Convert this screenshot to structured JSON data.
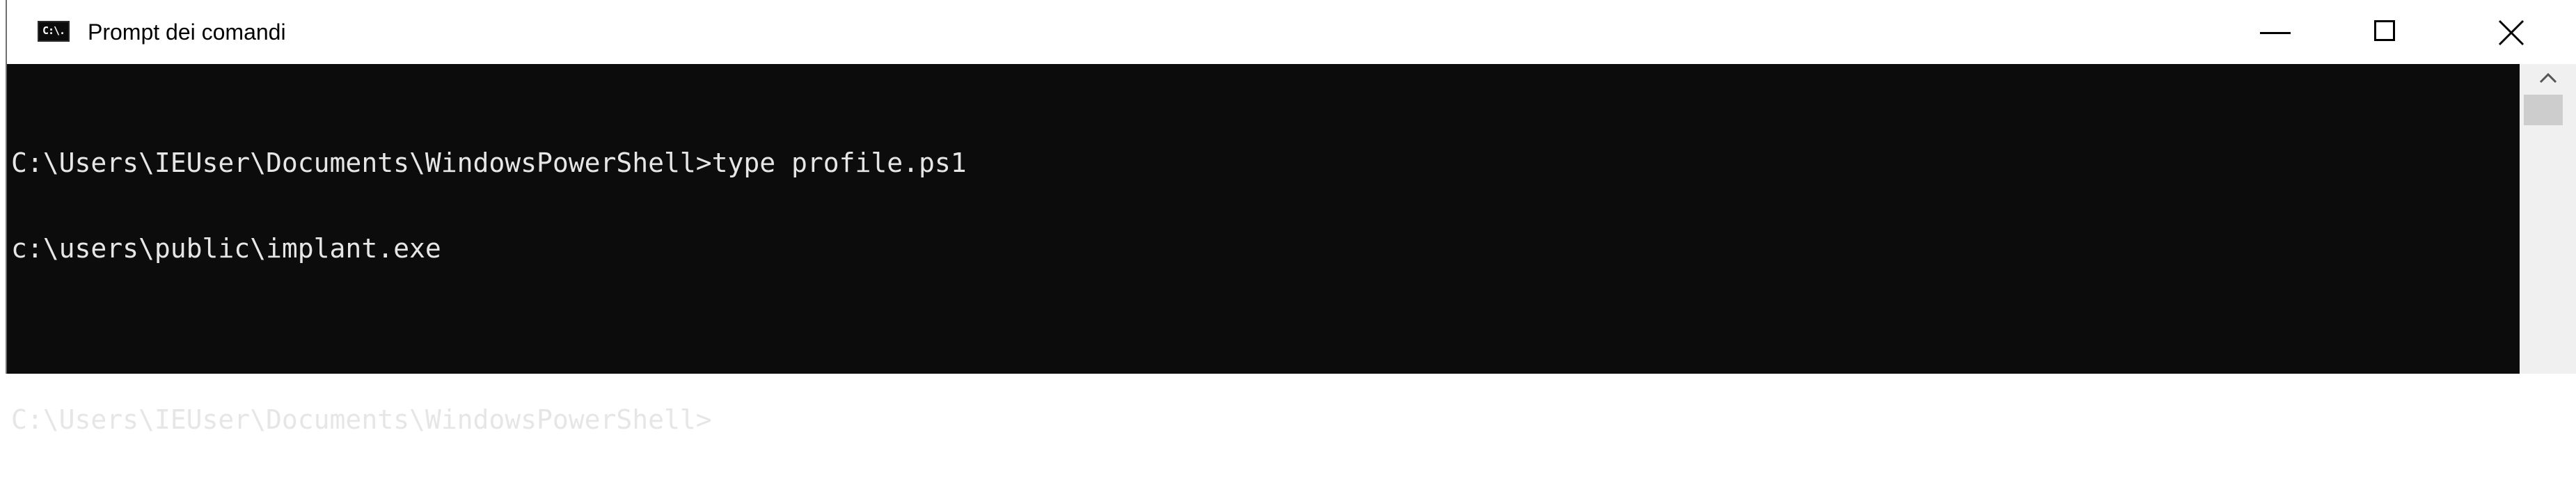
{
  "window": {
    "title": "Prompt dei comandi",
    "icon": "cmd-icon",
    "icon_text": "C:\\."
  },
  "caption_buttons": {
    "minimize": "minimize-icon",
    "maximize": "maximize-icon",
    "close": "close-icon"
  },
  "console": {
    "lines": [
      "C:\\Users\\IEUser\\Documents\\WindowsPowerShell>type profile.ps1",
      "c:\\users\\public\\implant.exe",
      "",
      "C:\\Users\\IEUser\\Documents\\WindowsPowerShell>"
    ]
  },
  "colors": {
    "console_bg": "#0c0c0c",
    "console_fg": "#e6e6e6",
    "titlebar_bg": "#ffffff"
  }
}
